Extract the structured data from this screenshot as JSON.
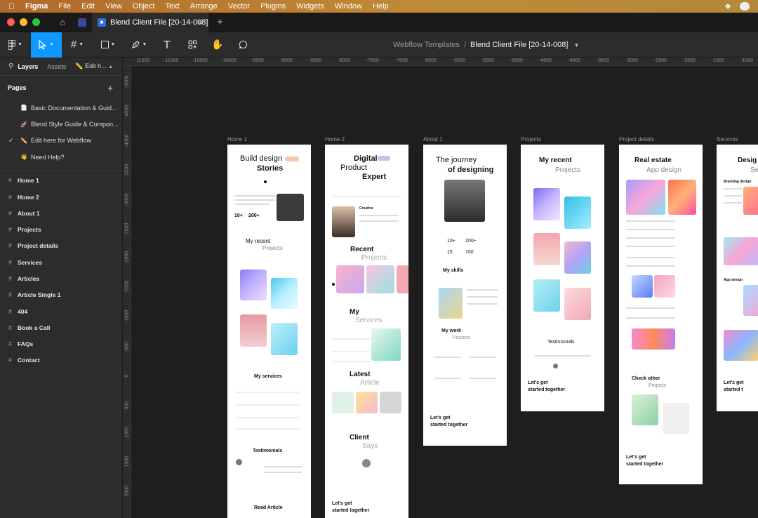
{
  "menubar": {
    "apple": "",
    "app": "Figma",
    "items": [
      "File",
      "Edit",
      "View",
      "Object",
      "Text",
      "Arrange",
      "Vector",
      "Plugins",
      "Widgets",
      "Window",
      "Help"
    ]
  },
  "tabs": {
    "active_title": "Blend Client File [20-14-008]",
    "close": "×",
    "new_tab": "+"
  },
  "toolbar": {
    "breadcrumb_project": "Webflow Templates",
    "breadcrumb_sep": "/",
    "breadcrumb_file": "Blend Client File [20-14-008]",
    "text_tool": "T"
  },
  "panel": {
    "tab_layers": "Layers",
    "tab_assets": "Assets",
    "tab_edit": "Edit h...",
    "pages_title": "Pages",
    "add_page": "+",
    "pages": [
      {
        "icon": "📄",
        "label": "Basic Documentation & Guid..."
      },
      {
        "icon": "🚀",
        "label": "Blend Style Guide & Compon..."
      },
      {
        "icon": "✏️",
        "label": "Edit here for Webflow"
      },
      {
        "icon": "👋",
        "label": "Need Help?"
      }
    ],
    "layers": [
      "Home 1",
      "Home 2",
      "About 1",
      "Projects",
      "Project details",
      "Services",
      "Articles",
      "Article Single 1",
      "404",
      "Book a Call",
      "FAQs",
      "Contact"
    ]
  },
  "ruler_top": [
    "-11500",
    "-11000",
    "-10500",
    "-10000",
    "-9500",
    "-9000",
    "-8500",
    "-8000",
    "-7500",
    "-7000",
    "-6500",
    "-6000",
    "-5500",
    "-5000",
    "-4500",
    "-4000",
    "-3500",
    "-3000",
    "-2500",
    "-2000",
    "-1500",
    "-1000"
  ],
  "ruler_left": [
    "-5000",
    "-4500",
    "-4000",
    "-3500",
    "-3000",
    "-2500",
    "-2000",
    "-1500",
    "-1000",
    "-500",
    "0",
    "500",
    "1000",
    "1500",
    "2000"
  ],
  "frames": {
    "home1": {
      "label": "Home 1",
      "h1a": "Build design",
      "h1b": "Stories",
      "stat1": "10+",
      "stat2": "200+",
      "recent_a": "My recent",
      "recent_b": "Projects",
      "services": "My services",
      "testimonials": "Testimonials",
      "read": "Read Article"
    },
    "home2": {
      "label": "Home 2",
      "h1a": "Digital",
      "h1b": "Product",
      "h1c": "Expert",
      "creative": "Creative",
      "recent_a": "Recent",
      "recent_b": "Projects",
      "my_a": "My",
      "my_b": "Services",
      "latest_a": "Latest",
      "latest_b": "Article",
      "client_a": "Client",
      "client_b": "Says",
      "cta_a": "Let's get",
      "cta_b": "started together"
    },
    "about1": {
      "label": "About 1",
      "h1a": "The journey",
      "h1b": "of designing",
      "s1": "10+",
      "s2": "200+",
      "s3": "15",
      "s4": "150",
      "skills": "My skills",
      "work_a": "My work",
      "work_b": "Process",
      "cta_a": "Let's get",
      "cta_b": "started together"
    },
    "projects": {
      "label": "Projects",
      "h1a": "My recent",
      "h1b": "Projects",
      "testimonials": "Testimonials",
      "cta_a": "Let's get",
      "cta_b": "started together"
    },
    "details": {
      "label": "Project details",
      "h1a": "Real estate",
      "h1b": "App design",
      "other_a": "Check other",
      "other_b": "Projects",
      "cta_a": "Let's get",
      "cta_b": "started together"
    },
    "services": {
      "label": "Services",
      "h1a": "Desig",
      "h1b": "Se",
      "branding": "Branding design",
      "app": "App design",
      "cta_a": "Let's get",
      "cta_b": "started t"
    }
  }
}
